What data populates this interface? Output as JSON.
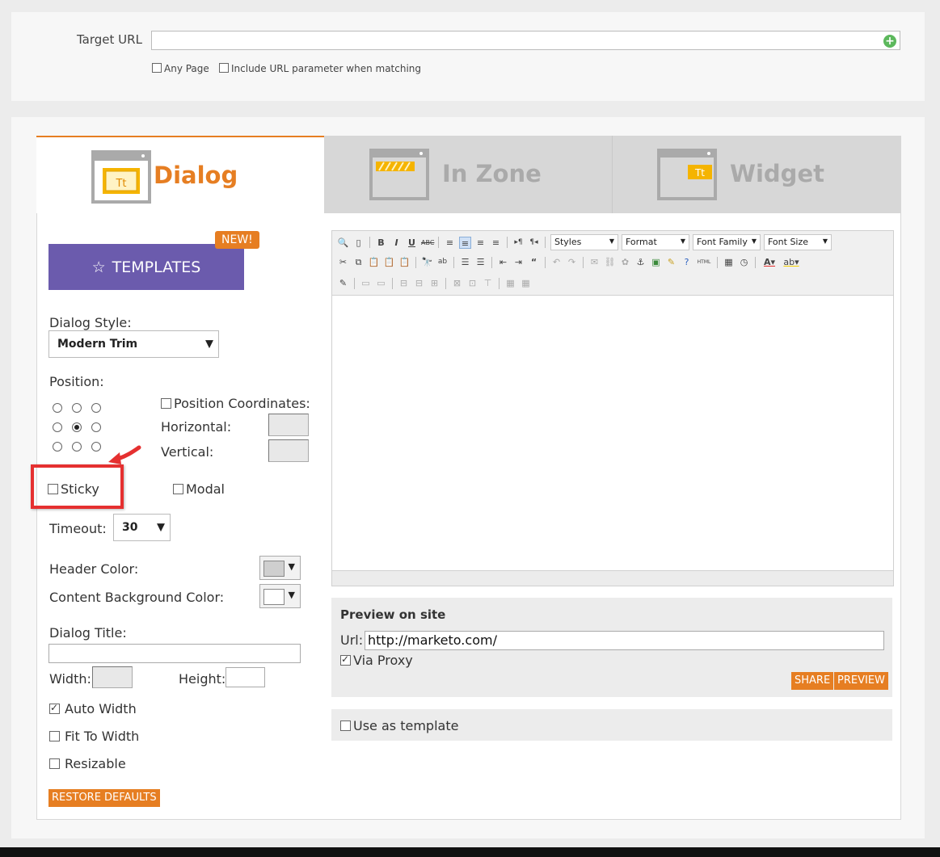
{
  "target": {
    "label": "Target URL",
    "url_value": "",
    "any_page_label": "Any Page",
    "include_param_label": "Include URL parameter when matching"
  },
  "tabs": [
    {
      "label": "Dialog",
      "active": true,
      "icon": "dialog-window-icon"
    },
    {
      "label": "In Zone",
      "active": false,
      "icon": "inzone-window-icon"
    },
    {
      "label": "Widget",
      "active": false,
      "icon": "widget-window-icon"
    }
  ],
  "templates": {
    "label": "TEMPLATES",
    "badge": "NEW!",
    "icon": "star-icon"
  },
  "settings": {
    "dialog_style_label": "Dialog Style:",
    "dialog_style_value": "Modern Trim",
    "position_label": "Position:",
    "position_coords_label": "Position Coordinates:",
    "horizontal_label": "Horizontal:",
    "vertical_label": "Vertical:",
    "sticky_label": "Sticky",
    "modal_label": "Modal",
    "timeout_label": "Timeout:",
    "timeout_value": "30",
    "header_color_label": "Header Color:",
    "content_bg_label": "Content Background Color:",
    "dialog_title_label": "Dialog Title:",
    "width_label": "Width:",
    "height_label": "Height:",
    "auto_width_label": "Auto Width",
    "fit_to_width_label": "Fit To Width",
    "resizable_label": "Resizable",
    "restore_defaults_label": "RESTORE DEFAULTS"
  },
  "editor": {
    "styles_label": "Styles",
    "format_label": "Format",
    "font_family_label": "Font Family",
    "font_size_label": "Font Size"
  },
  "preview": {
    "title": "Preview on site",
    "url_label": "Url:",
    "url_value": "http://marketo.com/",
    "via_proxy_label": "Via Proxy",
    "share_label": "SHARE",
    "preview_label": "PREVIEW"
  },
  "use_template_label": "Use as template",
  "colors": {
    "accent": "#e67e22",
    "templates": "#6b5bad",
    "highlight": "#e53030"
  }
}
